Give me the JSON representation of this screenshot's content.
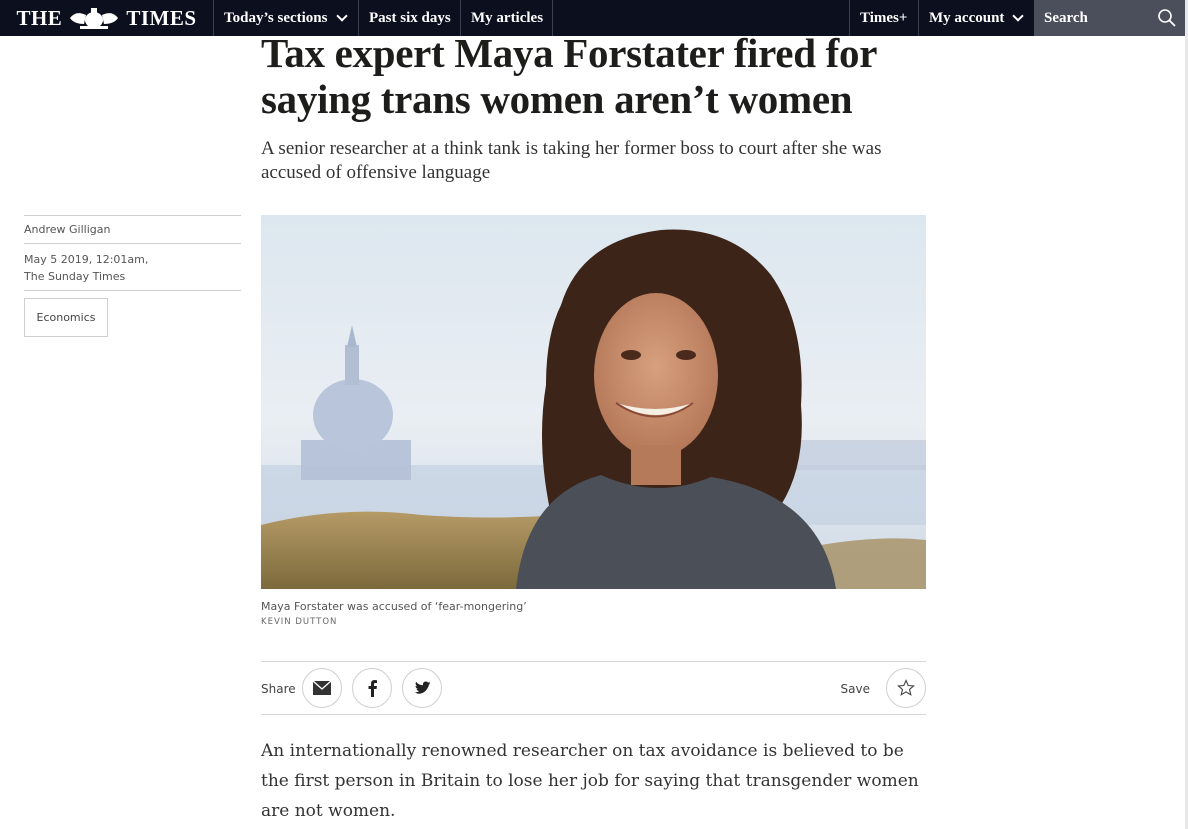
{
  "nav": {
    "logo_left": "THE",
    "logo_right": "TIMES",
    "crest_icon": "royal-crest-icon",
    "sections": "Today’s sections",
    "past_six_days": "Past six days",
    "my_articles": "My articles",
    "times_plus": "Times+",
    "my_account": "My account",
    "search_placeholder": "Search"
  },
  "sidebar": {
    "author": "Andrew Gilligan",
    "date": "May 5 2019, 12:01am,",
    "publication": "The Sunday Times",
    "tag": "Economics"
  },
  "article": {
    "headline": "Tax expert Maya Forstater fired for saying trans women aren’t women",
    "standfirst": "A senior researcher at a think tank is taking her former boss to court after she was accused of offensive language",
    "image_caption": "Maya Forstater was accused of ‘fear-mongering’",
    "image_credit": "KEVIN DUTTON",
    "share_label": "Share",
    "save_label": "Save",
    "body": "An internationally renowned researcher on tax avoidance is believed to be the first person in Britain to lose her job for saying that transgender women are not women."
  },
  "colors": {
    "nav_background": "#0b0f1e",
    "search_background": "#4b4e5b",
    "text": "#1d1d1b"
  },
  "icons": [
    "chevron-down-icon",
    "search-icon",
    "email-icon",
    "facebook-icon",
    "twitter-icon",
    "star-icon"
  ]
}
